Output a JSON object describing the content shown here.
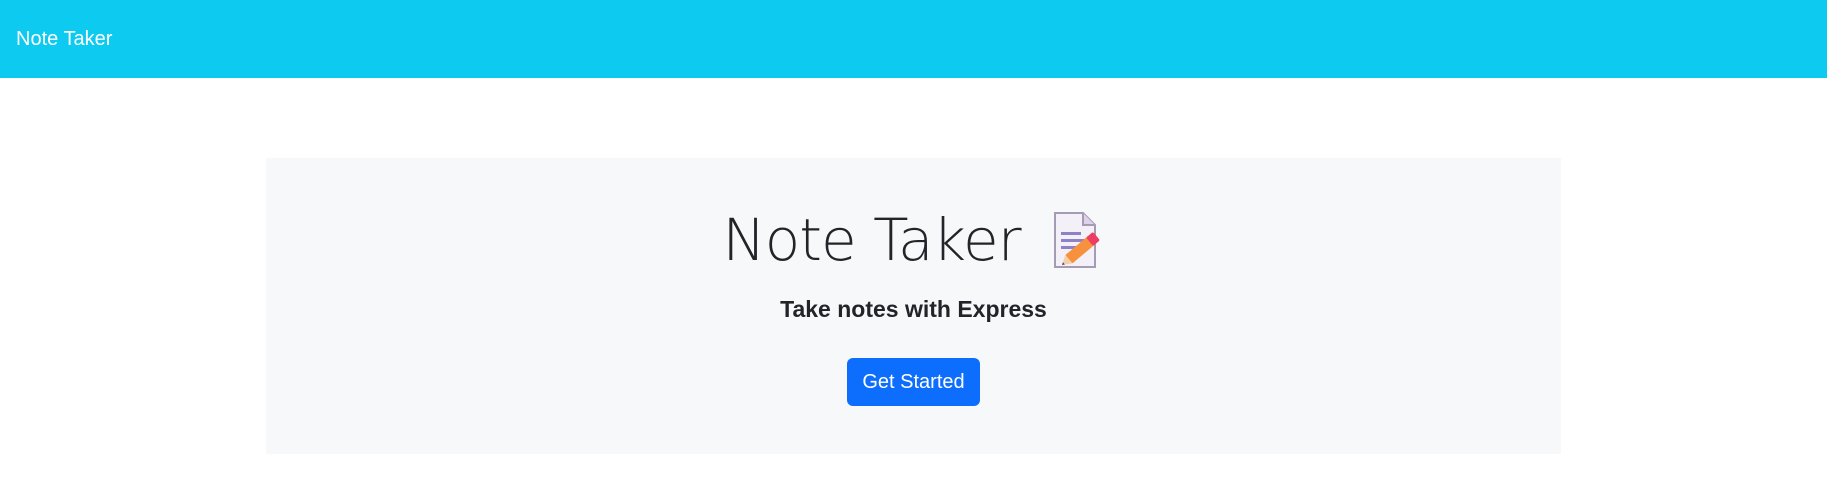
{
  "navbar": {
    "brand": "Note Taker",
    "background_color": "#0dcaf0"
  },
  "hero": {
    "title": "Note Taker",
    "icon": "memo-pencil-icon",
    "subtitle": "Take notes with Express",
    "cta_label": "Get Started",
    "cta_color": "#0d6efd",
    "background_color": "#f7f8f9"
  }
}
